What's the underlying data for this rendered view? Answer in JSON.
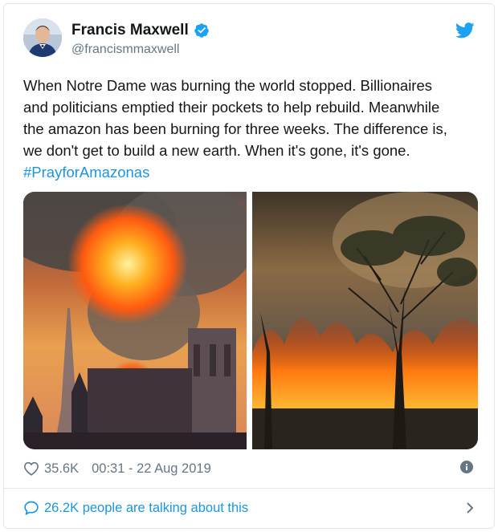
{
  "author": {
    "name": "Francis Maxwell",
    "handle": "@francismmaxwell",
    "verified": true
  },
  "tweet": {
    "text_lines": [
      "When Notre Dame was burning the world stopped. Billionaires",
      "and politicians emptied their pockets to help rebuild. Meanwhile",
      "the amazon has been burning for three weeks. The difference is,",
      "we don't get to build a new earth. When it's gone, it's gone."
    ],
    "hashtag": "#PrayforAmazonas"
  },
  "media": {
    "images": [
      "notre-dame-fire",
      "amazon-forest-fire"
    ]
  },
  "meta": {
    "likes": "35.6K",
    "timestamp": "00:31 - 22 Aug 2019"
  },
  "conversation": {
    "label": "26.2K people are talking about this"
  },
  "colors": {
    "link": "#1b95e0",
    "muted": "#657786",
    "verified": "#1da1f2",
    "border": "#e1e8ed"
  },
  "icons": [
    "verified-badge-icon",
    "twitter-bird-icon",
    "heart-icon",
    "info-icon",
    "speech-bubble-icon",
    "chevron-right-icon"
  ]
}
